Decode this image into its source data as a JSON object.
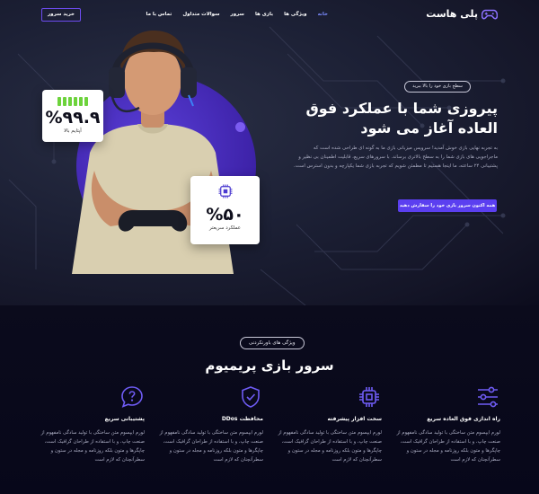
{
  "header": {
    "brand": "پلی هاست",
    "buy_label": "خرید سرور",
    "nav": [
      "خانه",
      "ویژگی ها",
      "بازی ها",
      "سرور",
      "سوالات متداول",
      "تماس با ما"
    ],
    "active_index": 0
  },
  "hero": {
    "pill": "سطح بازی خود را بالا ببرید",
    "title": "پیروزی شما با عملکرد فوق العاده آغاز می شود",
    "description": "به تجربه نهایی بازی خوش آمدید! سرویس میزبانی بازی ما به گونه ای طراحی شده است که ماجراجویی های بازی شما را به سطح بالاتری برساند. با سرورهای سریع، قابلیت اطمینان بی نظیر و پشتیبانی ۲۴ ساعته، ما اینجا هستیم تا مطمئن شویم که تجربه بازی شما یکپارچه و بدون استرس است.",
    "cta": "همه اکنون سرور بازی خود را سفارش دهید",
    "stat_uptime": {
      "value": "%۹۹.۹",
      "label": "آپتایم بالا"
    },
    "stat_perf": {
      "value": "%۵۰",
      "label": "عملکرد سریعتر"
    }
  },
  "section": {
    "pill": "ویژگی های باورنکردنی",
    "title": "سرور بازی پریمیوم",
    "features": [
      {
        "icon": "sliders-icon",
        "title": "راه اندازی فوق العاده سریع",
        "text": "لورم ایپسوم متن ساختگی با تولید سادگی نامفهوم از صنعت چاپ، و با استفاده از طراحان گرافیک است، چاپگرها و متون بلکه روزنامه و مجله در ستون و سطرآنچنان که لازم است"
      },
      {
        "icon": "cpu-icon",
        "title": "سخت افزار پیشرفته",
        "text": "لورم ایپسوم متن ساختگی با تولید سادگی نامفهوم از صنعت چاپ، و با استفاده از طراحان گرافیک است، چاپگرها و متون بلکه روزنامه و مجله در ستون و سطرآنچنان که لازم است"
      },
      {
        "icon": "shield-check-icon",
        "title": "محافظت DDos",
        "text": "لورم ایپسوم متن ساختگی با تولید سادگی نامفهوم از صنعت چاپ، و با استفاده از طراحان گرافیک است، چاپگرها و متون بلکه روزنامه و مجله در ستون و سطرآنچنان که لازم است"
      },
      {
        "icon": "help-chat-icon",
        "title": "پشتیبانی سریع",
        "text": "لورم ایپسوم متن ساختگی با تولید سادگی نامفهوم از صنعت چاپ، و با استفاده از طراحان گرافیک است، چاپگرها و متون بلکه روزنامه و مجله در ستون و سطرآنچنان که لازم است"
      }
    ]
  },
  "colors": {
    "accent": "#5b3ff0",
    "hero_circle": "#3d22a8",
    "green": "#6dd33c"
  }
}
